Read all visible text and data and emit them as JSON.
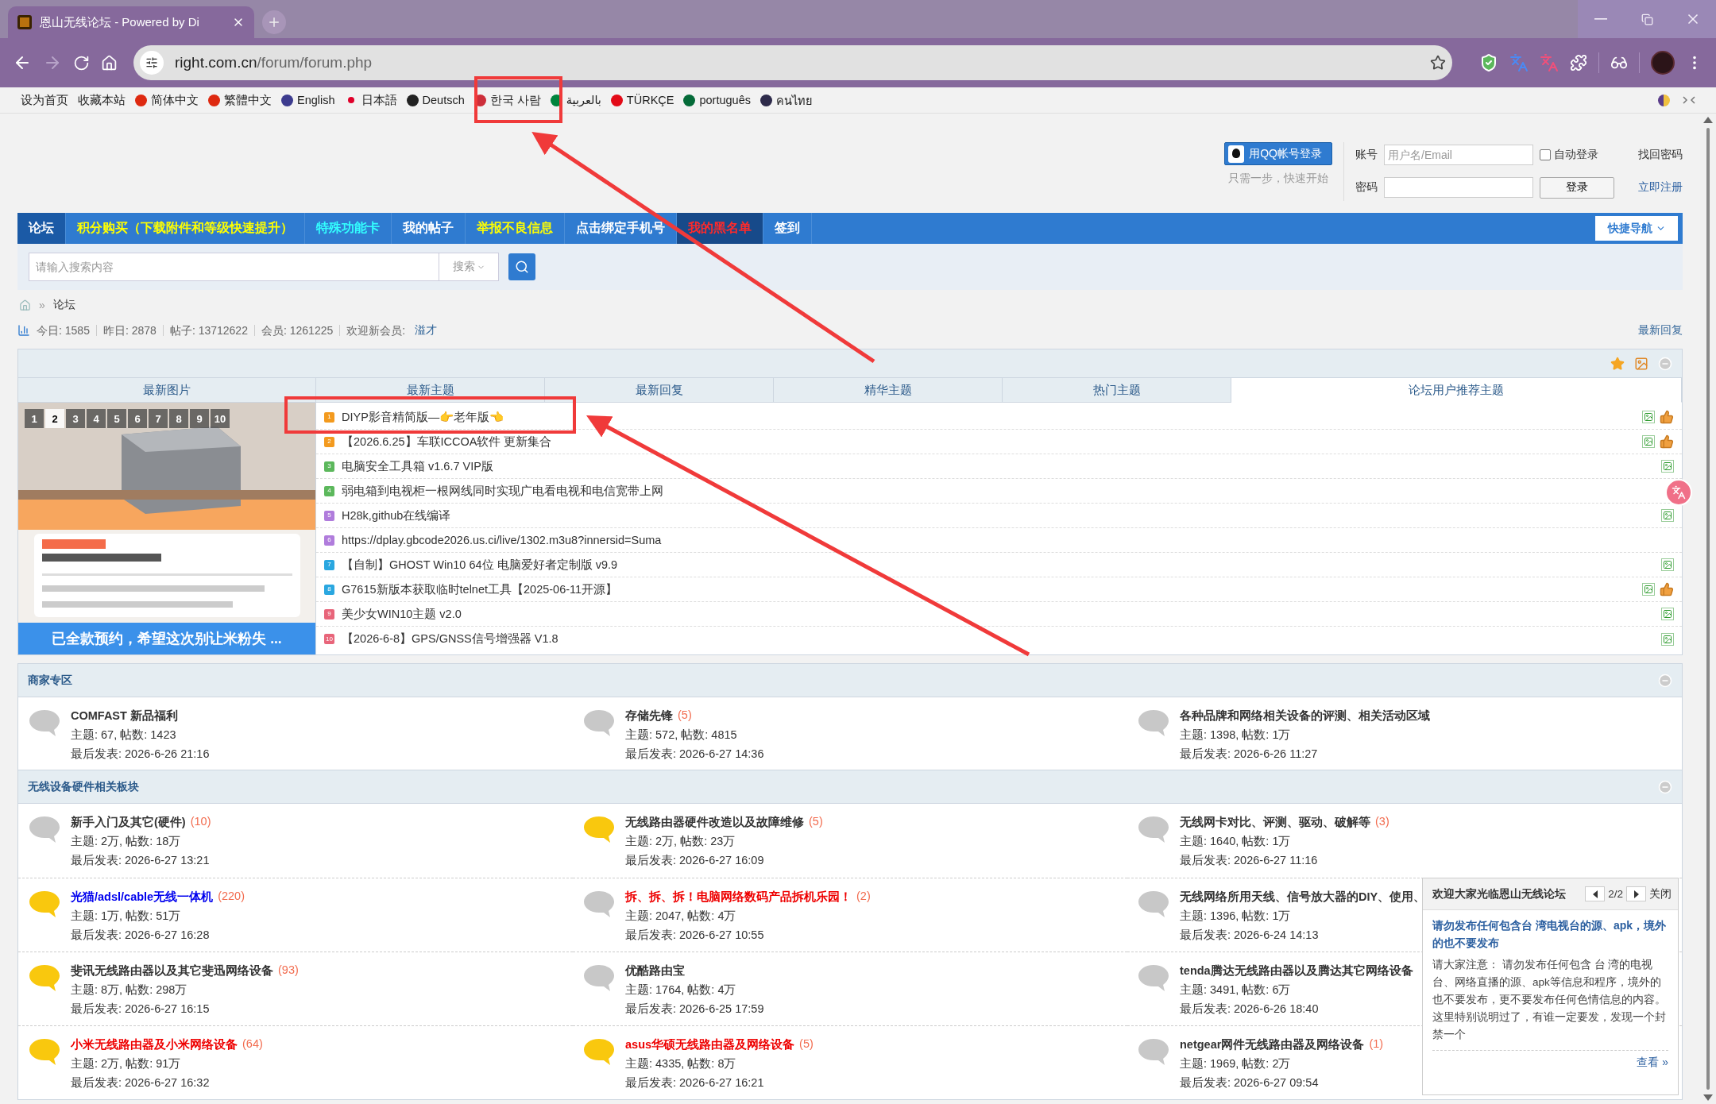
{
  "browser": {
    "tab_title": "恩山无线论坛 - Powered by Di",
    "url_host": "right.com.cn",
    "url_path": "/forum/forum.php"
  },
  "bookmarks": [
    {
      "label": "设为首页"
    },
    {
      "label": "收藏本站"
    },
    {
      "label": "简体中文",
      "color": "#de2910"
    },
    {
      "label": "繁體中文",
      "color": "#de2910"
    },
    {
      "label": "English",
      "color": "#3c3b8e"
    },
    {
      "label": "日本語",
      "color": "#e0002a"
    },
    {
      "label": "Deutsch",
      "color": "#222222"
    },
    {
      "label": "한국 사람",
      "color": "#cd2e3a"
    },
    {
      "label": "بالعربية",
      "color": "#00843d"
    },
    {
      "label": "TÜRKÇE",
      "color": "#e30a17"
    },
    {
      "label": "português",
      "color": "#046a38"
    },
    {
      "label": "คนไทย",
      "color": "#2d2a4a"
    }
  ],
  "login": {
    "qq_button": "用QQ帐号登录",
    "qq_hint": "只需一步，快速开始",
    "account_label": "账号",
    "account_placeholder": "用户名/Email",
    "remember_label": "自动登录",
    "remember_checked": false,
    "forgot": "找回密码",
    "password_label": "密码",
    "login_button": "登录",
    "register": "立即注册"
  },
  "nav": {
    "items": [
      {
        "label": "论坛",
        "kind": "plain",
        "selected": true
      },
      {
        "label": "积分购买（下载附件和等级快速提升）",
        "kind": "promo",
        "selected": false
      },
      {
        "label": "特殊功能卡",
        "kind": "feature",
        "selected": false
      },
      {
        "label": "我的帖子",
        "kind": "plain",
        "selected": false
      },
      {
        "label": "举报不良信息",
        "kind": "promo",
        "selected": false
      },
      {
        "label": "点击绑定手机号",
        "kind": "plain",
        "selected": false
      },
      {
        "label": "我的黑名单",
        "kind": "alert",
        "selected": false
      },
      {
        "label": "签到",
        "kind": "plain",
        "selected": false
      }
    ],
    "quick_nav": "快捷导航"
  },
  "search": {
    "placeholder": "请输入搜索内容",
    "scope": "搜索"
  },
  "breadcrumb": {
    "separator": "»",
    "current": "论坛"
  },
  "stats": {
    "items": [
      "今日: 1585",
      "昨日: 2878",
      "帖子: 13712622",
      "会员: 1261225"
    ],
    "new_member_label": "欢迎新会员:",
    "new_member": "溢才",
    "latest_link": "最新回复"
  },
  "thread_panel": {
    "tabs": [
      {
        "label": "最新图片",
        "selected": false
      },
      {
        "label": "最新主题",
        "selected": false
      },
      {
        "label": "最新回复",
        "selected": false
      },
      {
        "label": "精华主题",
        "selected": false
      },
      {
        "label": "热门主题",
        "selected": false
      },
      {
        "label": "论坛用户推荐主题",
        "selected": true
      }
    ],
    "slider": {
      "pages": [
        {
          "label": "1",
          "selected": false
        },
        {
          "label": "2",
          "selected": true
        },
        {
          "label": "3",
          "selected": false
        },
        {
          "label": "4",
          "selected": false
        },
        {
          "label": "5",
          "selected": false
        },
        {
          "label": "6",
          "selected": false
        },
        {
          "label": "7",
          "selected": false
        },
        {
          "label": "8",
          "selected": false
        },
        {
          "label": "9",
          "selected": false
        },
        {
          "label": "10",
          "selected": false
        }
      ],
      "caption": "已全款预约，希望这次别让米粉失 ..."
    },
    "threads": [
      {
        "rank": "1",
        "color": "#f39a1e",
        "title": "DIYP影音精简版—👉老年版👈",
        "image": true,
        "liked": true
      },
      {
        "rank": "2",
        "color": "#f39a1e",
        "title": "【2026.6.25】车联ICCOA软件 更新集合",
        "image": true,
        "liked": true
      },
      {
        "rank": "3",
        "color": "#5cb85c",
        "title": "电脑安全工具箱 v1.6.7 VIP版",
        "image": true,
        "liked": false
      },
      {
        "rank": "4",
        "color": "#5cb85c",
        "title": "弱电箱到电视柜一根网线同时实现广电看电视和电信宽带上网",
        "image": false,
        "liked": false
      },
      {
        "rank": "5",
        "color": "#b07cdc",
        "title": "H28k,github在线编译",
        "image": true,
        "liked": false
      },
      {
        "rank": "6",
        "color": "#b07cdc",
        "title": "https://dplay.gbcode2026.us.ci/live/1302.m3u8?innersid=Suma",
        "image": false,
        "liked": false
      },
      {
        "rank": "7",
        "color": "#2aa7e0",
        "title": "【自制】GHOST Win10 64位 电脑爱好者定制版 v9.9",
        "image": true,
        "liked": false
      },
      {
        "rank": "8",
        "color": "#2aa7e0",
        "title": "G7615新版本获取临时telnet工具【2025-06-11开源】",
        "image": true,
        "liked": true
      },
      {
        "rank": "9",
        "color": "#e8657a",
        "title": "美少女WIN10主题 v2.0",
        "image": true,
        "liked": false
      },
      {
        "rank": "10",
        "color": "#e8657a",
        "title": "【2026-6-8】GPS/GNSS信号增强器 V1.8",
        "image": true,
        "liked": false
      }
    ]
  },
  "sections": [
    {
      "title": "商家专区",
      "forums": [
        {
          "name": "COMFAST 新品福利",
          "color": "#333333",
          "has_new": false,
          "stats": "主题: 67, 帖数: 1423",
          "last_post": "最后发表: 2026-6-26 21:16"
        },
        {
          "name": "存储先锋",
          "count": "(5)",
          "color": "#333333",
          "has_new": false,
          "stats": "主题: 572, 帖数: 4815",
          "last_post": "最后发表: 2026-6-27 14:36"
        },
        {
          "name": "各种品牌和网络相关设备的评测、相关活动区域",
          "color": "#333333",
          "has_new": false,
          "stats": "主题: 1398, 帖数: 1万",
          "last_post": "最后发表: 2026-6-26 11:27"
        }
      ]
    },
    {
      "title": "无线设备硬件相关板块",
      "forums": [
        {
          "name": "新手入门及其它(硬件)",
          "count": "(10)",
          "color": "#333333",
          "has_new": false,
          "stats": "主题: 2万, 帖数: 18万",
          "last_post": "最后发表: 2026-6-27 13:21"
        },
        {
          "name": "无线路由器硬件改造以及故障维修",
          "count": "(5)",
          "color": "#333333",
          "has_new": true,
          "stats": "主题: 2万, 帖数: 23万",
          "last_post": "最后发表: 2026-6-27 16:09"
        },
        {
          "name": "无线网卡对比、评测、驱动、破解等",
          "count": "(3)",
          "color": "#333333",
          "has_new": false,
          "stats": "主题: 1640, 帖数: 1万",
          "last_post": "最后发表: 2026-6-27 11:16"
        },
        {
          "name": "光猫/adsl/cable无线一体机",
          "count": "(220)",
          "color": "#0000ee",
          "has_new": true,
          "stats": "主题: 1万, 帖数: 51万",
          "last_post": "最后发表: 2026-6-27 16:28"
        },
        {
          "name": "拆、拆、拆！电脑网络数码产品拆机乐园！",
          "count": "(2)",
          "color": "#ee0000",
          "has_new": false,
          "stats": "主题: 2047, 帖数: 4万",
          "last_post": "最后发表: 2026-6-27 10:55"
        },
        {
          "name": "无线网络所用天线、信号放大器的DIY、使用、",
          "color": "#333333",
          "has_new": false,
          "stats": "主题: 1396, 帖数: 1万",
          "last_post": "最后发表: 2026-6-24 14:13"
        },
        {
          "name": "斐讯无线路由器以及其它斐迅网络设备",
          "count": "(93)",
          "color": "#333333",
          "has_new": true,
          "stats": "主题: 8万, 帖数: 298万",
          "last_post": "最后发表: 2026-6-27 16:15"
        },
        {
          "name": "优酷路由宝",
          "color": "#333333",
          "has_new": false,
          "stats": "主题: 1764, 帖数: 4万",
          "last_post": "最后发表: 2026-6-25 17:59"
        },
        {
          "name": "tenda腾达无线路由器以及腾达其它网络设备",
          "color": "#333333",
          "has_new": false,
          "stats": "主题: 3491, 帖数: 6万",
          "last_post": "最后发表: 2026-6-26 18:40"
        },
        {
          "name": "小米无线路由器及小米网络设备",
          "count": "(64)",
          "color": "#ee0000",
          "has_new": true,
          "stats": "主题: 2万, 帖数: 91万",
          "last_post": "最后发表: 2026-6-27 16:32"
        },
        {
          "name": "asus华硕无线路由器及网络设备",
          "count": "(5)",
          "color": "#ee0000",
          "has_new": true,
          "stats": "主题: 4335, 帖数: 8万",
          "last_post": "最后发表: 2026-6-27 16:21"
        },
        {
          "name": "netgear网件无线路由器及网络设备",
          "count": "(1)",
          "color": "#333333",
          "has_new": false,
          "stats": "主题: 1969, 帖数: 2万",
          "last_post": "最后发表: 2026-6-27 09:54"
        }
      ]
    }
  ],
  "popup": {
    "title": "欢迎大家光临恩山无线论坛",
    "page": "2/2",
    "close": "关闭",
    "headline": "请勿发布任何包含台 湾电视台的源、apk，境外的也不要发布",
    "body": "请大家注意：  请勿发布任何包含 台 湾的电视台、网络直播的源、apk等信息和程序，境外的也不要发布，更不要发布任何色情信息的内容。这里特别说明过了，有谁一定要发，发现一个封禁一个",
    "more": "查看 »"
  }
}
